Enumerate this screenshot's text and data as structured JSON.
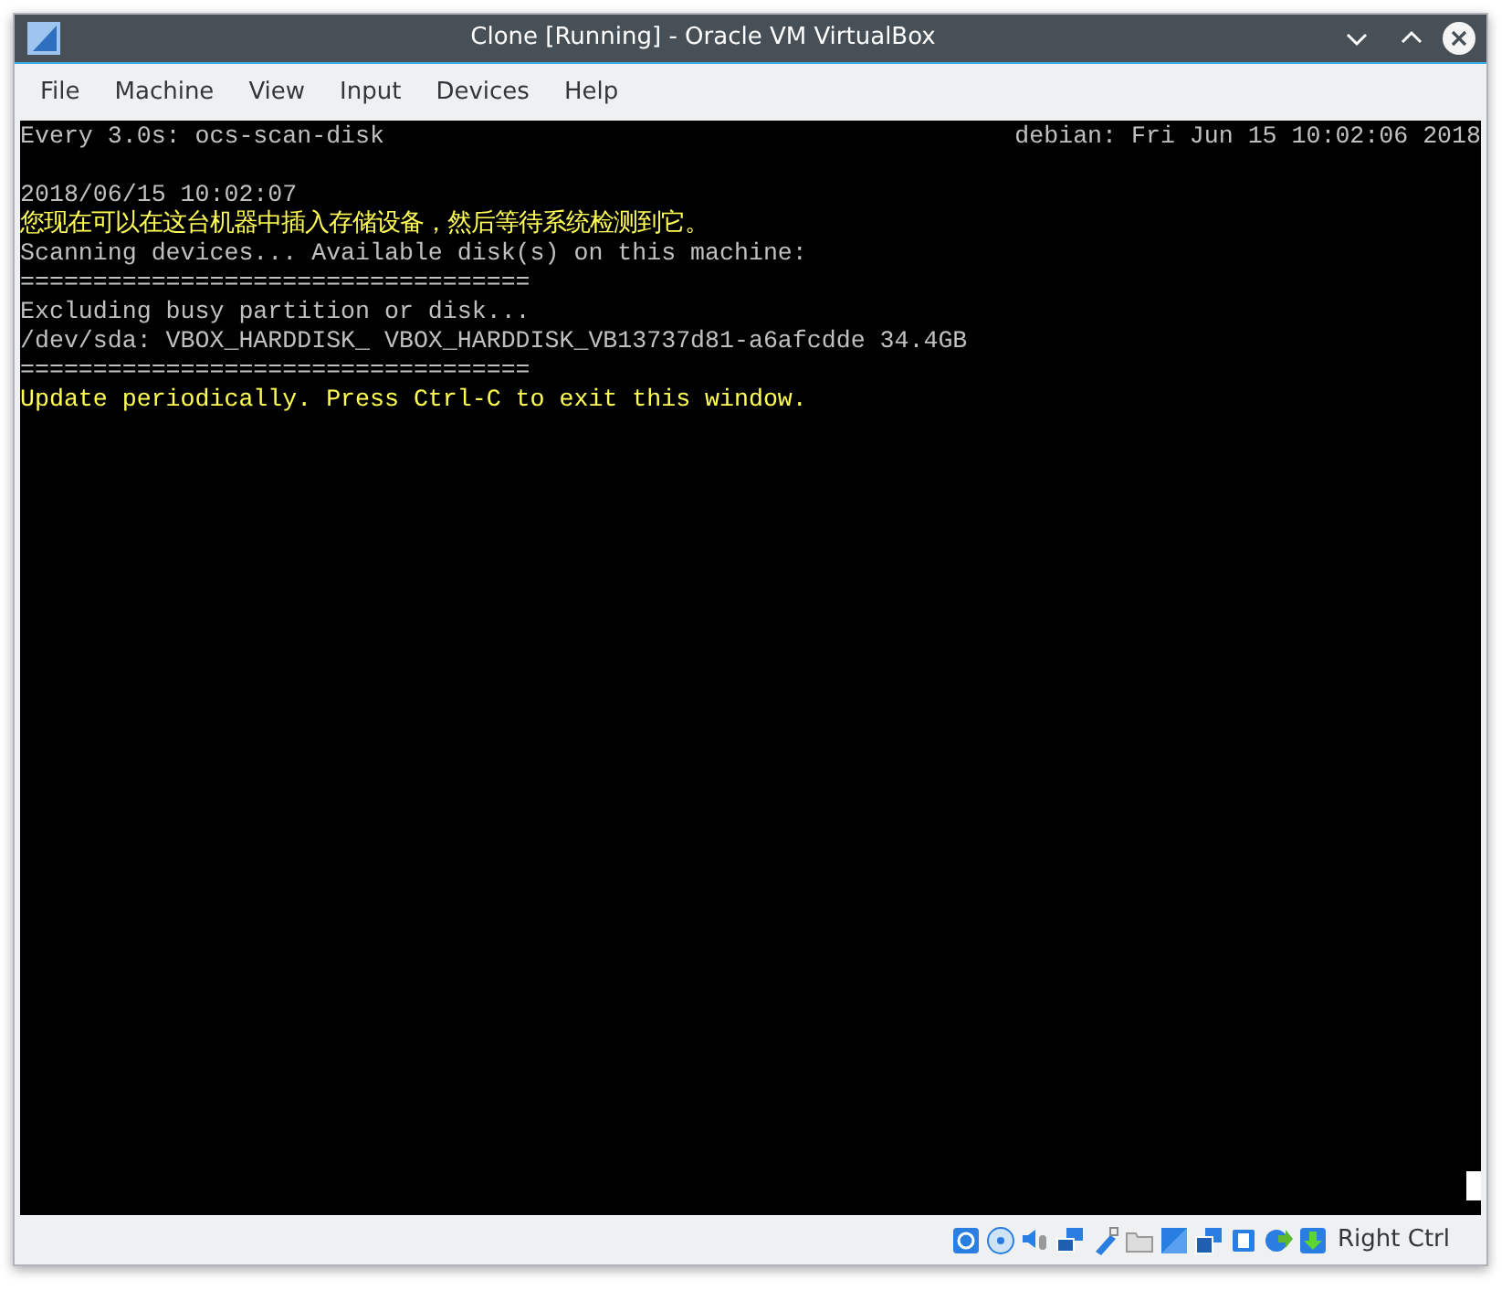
{
  "window": {
    "title": "Clone [Running] - Oracle VM VirtualBox"
  },
  "menu": [
    "File",
    "Machine",
    "View",
    "Input",
    "Devices",
    "Help"
  ],
  "terminal": {
    "header_left": "Every 3.0s: ocs-scan-disk",
    "header_right": "debian: Fri Jun 15 10:02:06 2018",
    "lines": [
      {
        "text": "2018/06/15 10:02:07",
        "color": "#c0c0c0"
      },
      {
        "text": "您现在可以在这台机器中插入存储设备，然后等待系统检测到它。",
        "color": "#ffff55"
      },
      {
        "text": "Scanning devices... Available disk(s) on this machine:",
        "color": "#c0c0c0"
      },
      {
        "text": "===================================",
        "color": "#c0c0c0"
      },
      {
        "text": "Excluding busy partition or disk...",
        "color": "#c0c0c0"
      },
      {
        "text": "/dev/sda: VBOX_HARDDISK_ VBOX_HARDDISK_VB13737d81-a6afcdde 34.4GB",
        "color": "#c0c0c0"
      },
      {
        "text": "===================================",
        "color": "#c0c0c0"
      },
      {
        "text": "Update periodically. Press Ctrl-C to exit this window.",
        "color": "#ffff55"
      }
    ]
  },
  "status_bar": {
    "host_key": "Right Ctrl"
  }
}
